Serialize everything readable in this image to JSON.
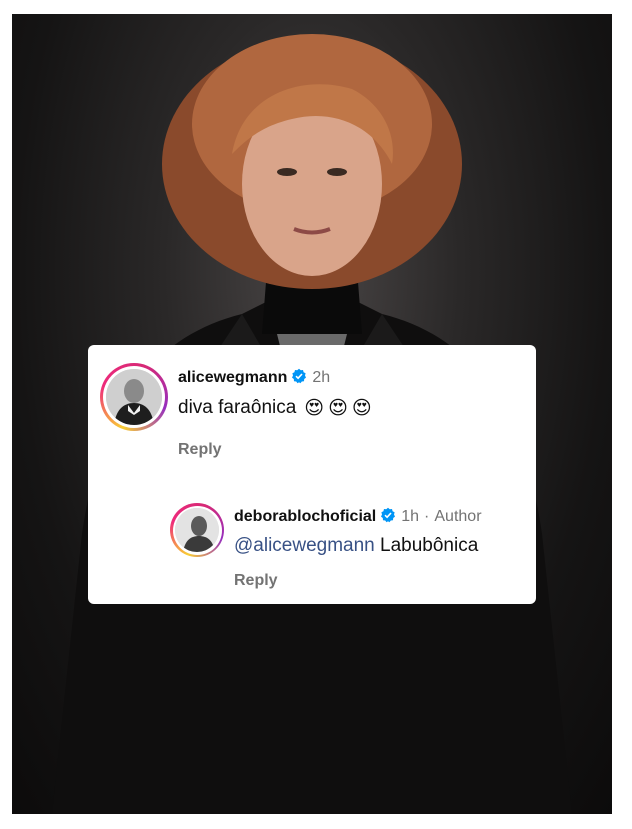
{
  "comment": {
    "username": "alicewegmann",
    "time": "2h",
    "text": "diva faraônica",
    "emoji": [
      "😍",
      "😍",
      "😍"
    ],
    "reply_label": "Reply",
    "avatar": "avatar-alicewegmann"
  },
  "reply": {
    "username": "deborablochoficial",
    "time": "1h",
    "separator": "·",
    "author_tag": "Author",
    "mention": "@alicewegmann",
    "text": "Labubônica",
    "reply_label": "Reply",
    "avatar": "avatar-deborablochoficial"
  },
  "colors": {
    "accent": "#385185",
    "verified": "#0095f6",
    "muted": "#737373"
  }
}
